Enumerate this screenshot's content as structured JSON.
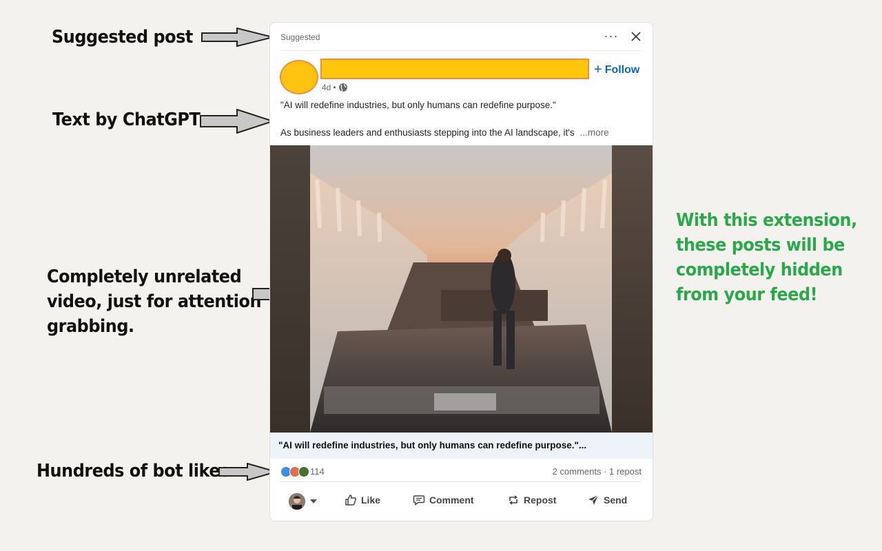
{
  "annotations": {
    "suggested": "Suggested post",
    "text_by": "Text by ChatGPT",
    "video_line1": "Completely unrelated",
    "video_line2": "video, just for attention",
    "video_line3": "grabbing.",
    "likes": "Hundreds of bot likes.",
    "ext_line1": "With this extension,",
    "ext_line2": "these posts will be",
    "ext_line3": "completely hidden",
    "ext_line4": "from your feed!"
  },
  "post": {
    "header_label": "Suggested",
    "follow_label": "Follow",
    "age": "4d",
    "separator": "•",
    "text_line1": "\"AI will redefine industries, but only humans can redefine purpose.\"",
    "text_line2": "As business leaders and enthusiasts stepping into the AI landscape, it's",
    "see_more": "...more",
    "video_caption": "\"AI will redefine industries, but only humans can redefine purpose.\"...",
    "like_count": "114",
    "comments_repost": "2 comments · 1 repost"
  },
  "actions": {
    "like": "Like",
    "comment": "Comment",
    "repost": "Repost",
    "send": "Send"
  },
  "colors": {
    "annotation_green": "#2aa84a",
    "linkedin_blue": "#0a66c2",
    "redaction_fill": "#ffc60b",
    "redaction_border": "#f58b3c"
  }
}
